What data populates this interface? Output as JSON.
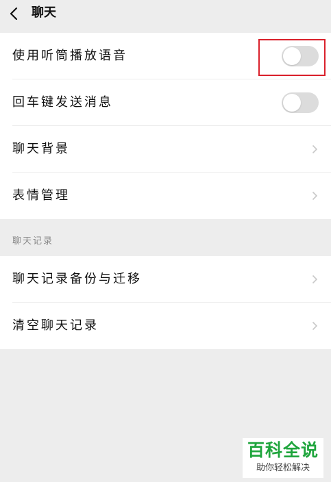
{
  "header": {
    "title": "聊天"
  },
  "group1": {
    "items": [
      {
        "label": "使用听筒播放语音",
        "control": "toggle",
        "on": false
      },
      {
        "label": "回车键发送消息",
        "control": "toggle",
        "on": false
      },
      {
        "label": "聊天背景",
        "control": "chevron"
      },
      {
        "label": "表情管理",
        "control": "chevron"
      }
    ]
  },
  "chat_history": {
    "header": "聊天记录",
    "items": [
      {
        "label": "聊天记录备份与迁移",
        "control": "chevron"
      },
      {
        "label": "清空聊天记录",
        "control": "chevron"
      }
    ]
  },
  "watermark": {
    "title": "百科全说",
    "subtitle": "助你轻松解决"
  },
  "colors": {
    "background": "#ededed",
    "card": "#ffffff",
    "toggle_off": "#dcdcdc",
    "highlight": "#d9202b",
    "watermark_green": "#1fa53d"
  }
}
